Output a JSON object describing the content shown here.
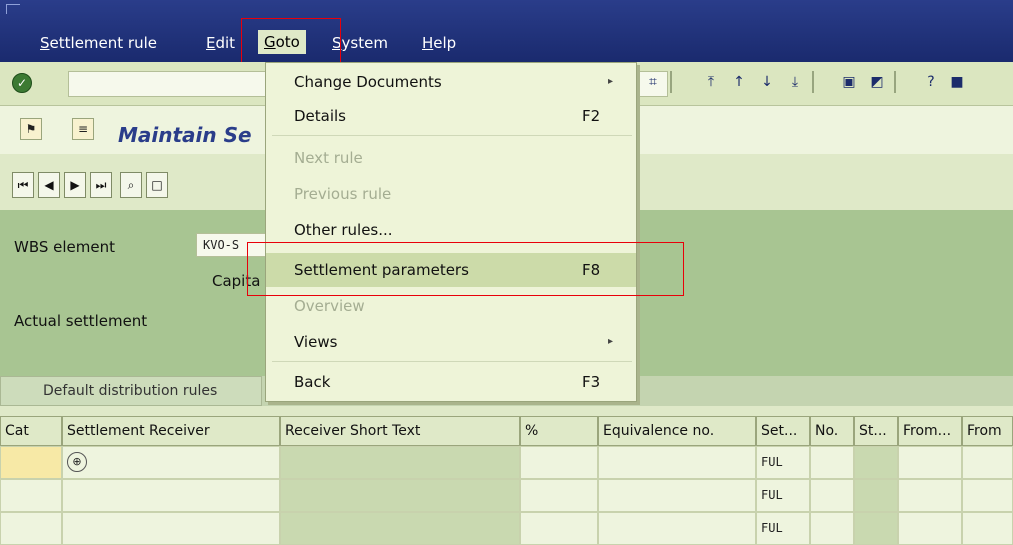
{
  "menubar": {
    "items": [
      {
        "label": "Settlement rule",
        "underline": "S",
        "rest": "ettlement rule"
      },
      {
        "label": "Edit",
        "underline": "E",
        "rest": "dit"
      },
      {
        "label": "Goto",
        "underline": "G",
        "rest": "oto"
      },
      {
        "label": "System",
        "underline": "S",
        "rest": "ystem"
      },
      {
        "label": "Help",
        "underline": "H",
        "rest": "elp"
      }
    ]
  },
  "title": "Maintain Se",
  "form": {
    "wbs_label": "WBS element",
    "wbs_value": "KVO-S",
    "capital_label": "Capita",
    "actual_label": "Actual settlement"
  },
  "tab": {
    "label": "Default distribution rules"
  },
  "table": {
    "headers": [
      "Cat",
      "Settlement Receiver",
      "Receiver Short Text",
      "%",
      "Equivalence no.",
      "Set...",
      "No.",
      "St...",
      "From...",
      "From"
    ],
    "rows": [
      {
        "set": "FUL"
      },
      {
        "set": "FUL"
      },
      {
        "set": "FUL"
      }
    ]
  },
  "dropdown": {
    "items": [
      {
        "label": "Change Documents",
        "key": "",
        "submenu": true,
        "disabled": false
      },
      {
        "label": "Details",
        "key": "F2",
        "submenu": false,
        "disabled": false
      },
      {
        "label": "Next rule",
        "key": "",
        "submenu": false,
        "disabled": true
      },
      {
        "label": "Previous rule",
        "key": "",
        "submenu": false,
        "disabled": true
      },
      {
        "label": "Other rules...",
        "key": "",
        "submenu": false,
        "disabled": false
      },
      {
        "label": "Settlement parameters",
        "key": "F8",
        "submenu": false,
        "disabled": false
      },
      {
        "label": "Overview",
        "key": "",
        "submenu": false,
        "disabled": true
      },
      {
        "label": "Views",
        "key": "",
        "submenu": true,
        "disabled": false
      },
      {
        "label": "Back",
        "key": "F3",
        "submenu": false,
        "disabled": false
      }
    ]
  },
  "colors": {
    "menubar": "#1f2f75",
    "accent": "#2a3d8a",
    "highlight_box": "#e8000a"
  }
}
